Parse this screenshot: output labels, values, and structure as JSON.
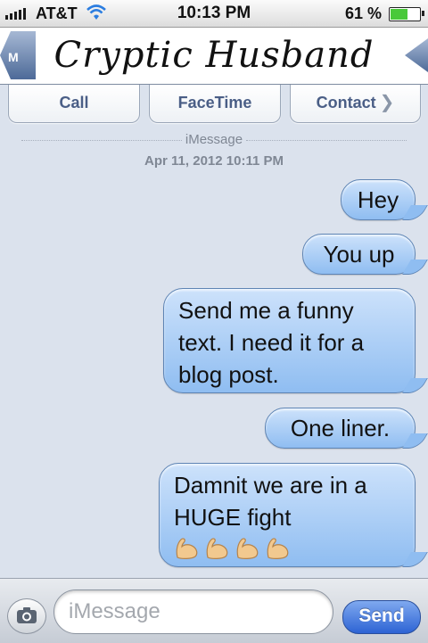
{
  "status_bar": {
    "carrier": "AT&T",
    "time": "10:13 PM",
    "battery_percent_label": "61 %",
    "battery_level": 0.61,
    "icons": [
      "signal-bars-icon",
      "wifi-icon",
      "battery-icon"
    ]
  },
  "header": {
    "back_label": "M",
    "contact_name": "Cryptic Husband"
  },
  "actions": {
    "call": "Call",
    "facetime": "FaceTime",
    "contact": "Contact"
  },
  "conversation": {
    "service": "iMessage",
    "date": "Apr 11, 2012 10:11 PM",
    "messages": [
      {
        "text": "Hey"
      },
      {
        "text": "You up"
      },
      {
        "text": "Send me a funny text. I need it for a blog post."
      },
      {
        "text": "One liner."
      },
      {
        "text": "Damnit we are in a HUGE fight",
        "emoji": [
          "flexed-biceps-icon",
          "flexed-biceps-icon",
          "flexed-biceps-icon",
          "flexed-biceps-icon"
        ]
      }
    ]
  },
  "composer": {
    "placeholder": "iMessage",
    "send_label": "Send"
  },
  "colors": {
    "bubble": "#a9cdf6",
    "send_button": "#3a6fd8",
    "background": "#dbe2ed",
    "battery_fill": "#49c93a"
  }
}
